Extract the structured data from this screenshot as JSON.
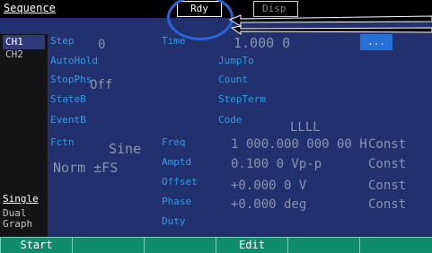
{
  "header": {
    "title": "Sequence",
    "status": "Rdy",
    "display_tab": "Disp"
  },
  "sidebar": {
    "ch1": "CH1",
    "ch2": "CH2",
    "single": "Single",
    "dual": "Dual",
    "graph": "Graph"
  },
  "params": {
    "step_label": "Step",
    "step_value": "0",
    "autohold_label": "AutoHold",
    "stopphs_label": "StopPhs",
    "stopphs_value": "Off",
    "stateb_label": "StateB",
    "eventb_label": "EventB",
    "fctn_label": "Fctn",
    "fctn_value": "Sine",
    "norm_value": "Norm ±FS",
    "time_label": "Time",
    "time_value": "1.000 0",
    "jumpto_label": "JumpTo",
    "count_label": "Count",
    "stepterm_label": "StepTerm",
    "code_label": "Code",
    "code_value": "LLLL",
    "more_button": "..."
  },
  "waveform": {
    "freq_label": "Freq",
    "freq_value": "1 000.000 000 00 H",
    "freq_mode": "Const",
    "amptd_label": "Amptd",
    "amptd_value": "0.100 0 Vp-p",
    "amptd_mode": "Const",
    "offset_label": "Offset",
    "offset_value": "+0.000 0 V",
    "offset_mode": "Const",
    "phase_label": "Phase",
    "phase_value": "+0.000 deg",
    "phase_mode": "Const",
    "duty_label": "Duty"
  },
  "softkeys": [
    "Start",
    "",
    "",
    "Edit",
    "",
    ""
  ],
  "colors": {
    "background": "#22306e",
    "label": "#2f9ae8",
    "value": "#8a93ae",
    "softkey": "#0f8c69",
    "highlight_ellipse": "#2a65d6",
    "arrow": "#000000"
  }
}
